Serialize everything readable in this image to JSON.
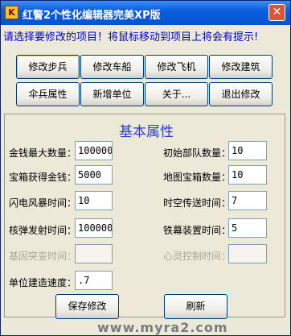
{
  "window": {
    "title": "红警2个性化编辑器完美XP版",
    "icon_glyph": "K",
    "close_glyph": "✕"
  },
  "prompt": "请选择要修改的项目！将鼠标移动到项目上将会有提示!",
  "buttons": {
    "row1": [
      "修改步兵",
      "修改车船",
      "修改飞机",
      "修改建筑"
    ],
    "row2": [
      "伞兵属性",
      "新增单位",
      "关于...",
      "退出修改"
    ]
  },
  "panel": {
    "title": "基本属性"
  },
  "fields": {
    "max_money": {
      "label": "金钱最大数量：",
      "value": "100000"
    },
    "crate_money": {
      "label": "宝箱获得金钱：",
      "value": "5000"
    },
    "lightning_time": {
      "label": "闪电风暴时间：",
      "value": "10"
    },
    "nuke_time": {
      "label": "核弹发射时间：",
      "value": "10000000"
    },
    "base_raid_time": {
      "label": "基因突变时间：",
      "value": ""
    },
    "build_speed": {
      "label": "单位建造速度：",
      "value": ".7"
    },
    "initial_units": {
      "label": "初始部队数量：",
      "value": "10"
    },
    "map_crates": {
      "label": "地图宝箱数量：",
      "value": "10"
    },
    "chrono_time": {
      "label": "时空传送时间：",
      "value": "7"
    },
    "iron_curtain_time": {
      "label": "铁幕装置时间：",
      "value": "5"
    },
    "psychic_time": {
      "label": "心灵控制时间：",
      "value": ""
    }
  },
  "footer": {
    "save": "保存修改",
    "refresh": "刷新"
  },
  "watermark": "www.myra2.com"
}
